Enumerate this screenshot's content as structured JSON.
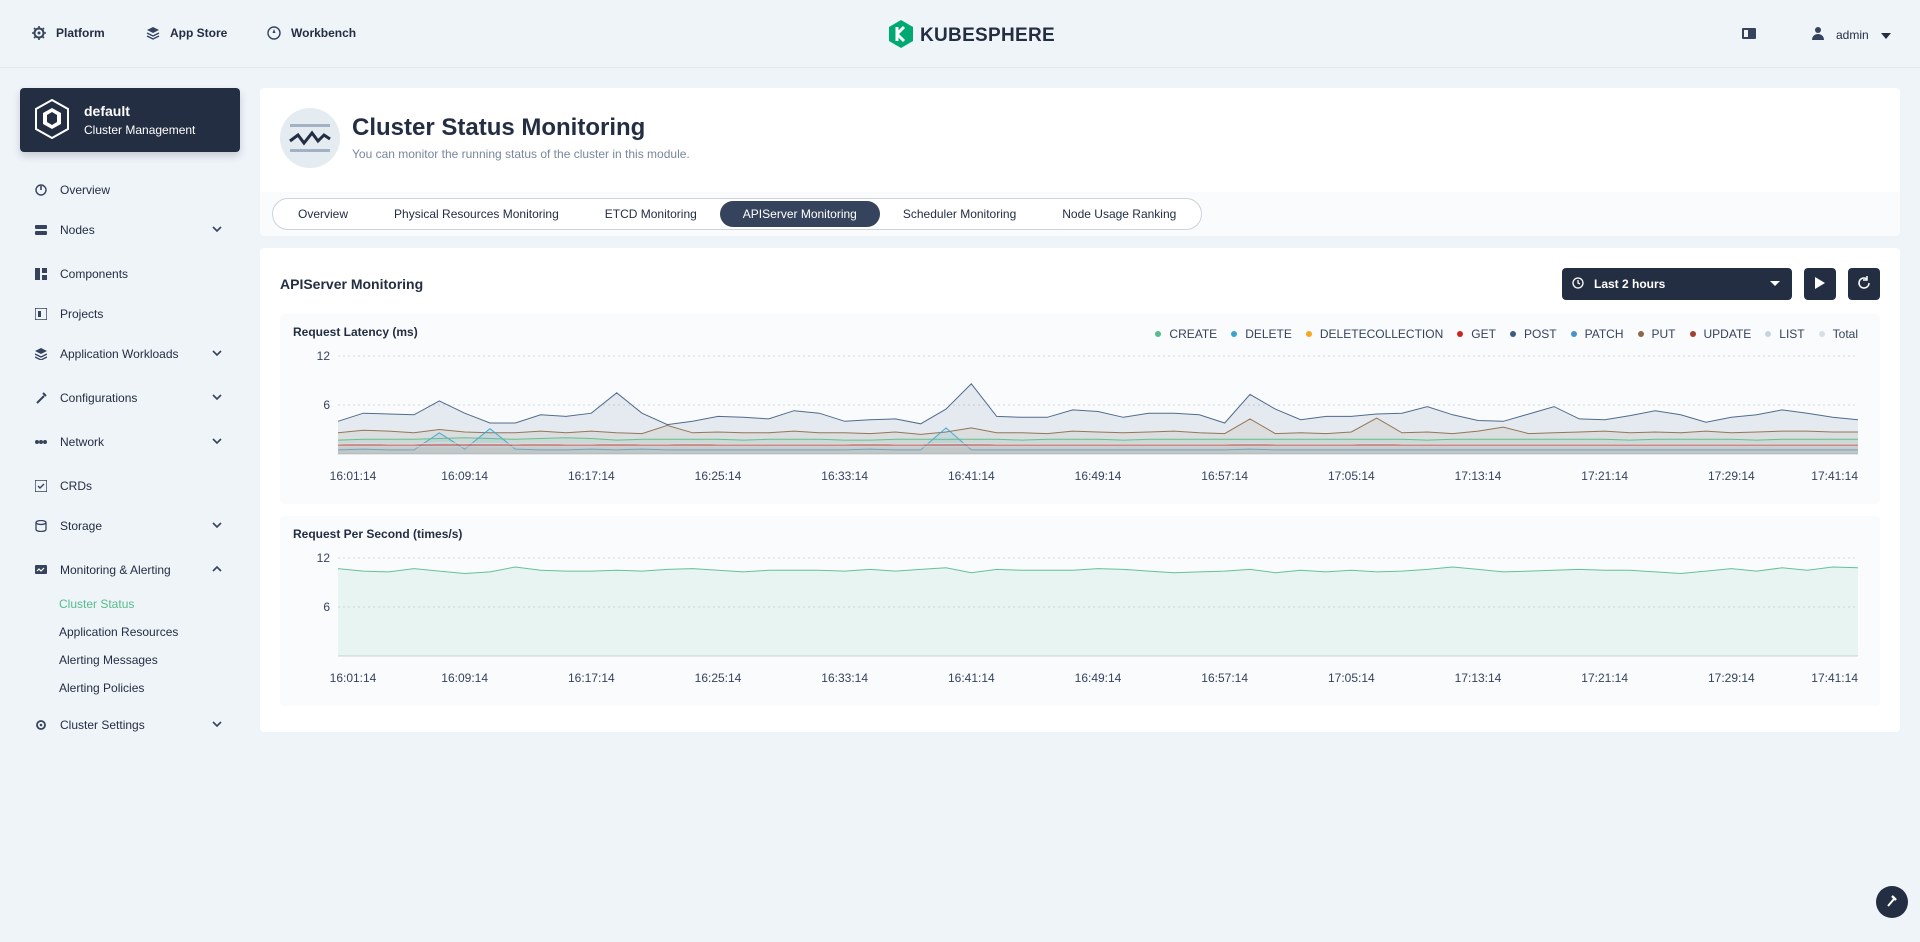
{
  "topnav": {
    "items": [
      {
        "label": "Platform",
        "icon": "gear-icon"
      },
      {
        "label": "App Store",
        "icon": "cube-icon"
      },
      {
        "label": "Workbench",
        "icon": "compass-icon"
      }
    ],
    "logo_text": "KUBESPHERE",
    "user": "admin"
  },
  "cluster": {
    "name": "default",
    "subtitle": "Cluster Management"
  },
  "sidebar": {
    "items": [
      {
        "label": "Overview",
        "icon": "dashboard-icon",
        "expandable": false
      },
      {
        "label": "Nodes",
        "icon": "nodes-icon",
        "expandable": true
      },
      {
        "label": "Components",
        "icon": "components-icon",
        "expandable": false
      },
      {
        "label": "Projects",
        "icon": "projects-icon",
        "expandable": false
      },
      {
        "label": "Application Workloads",
        "icon": "workloads-icon",
        "expandable": true
      },
      {
        "label": "Configurations",
        "icon": "wrench-icon",
        "expandable": true
      },
      {
        "label": "Network",
        "icon": "network-icon",
        "expandable": true
      },
      {
        "label": "CRDs",
        "icon": "crd-icon",
        "expandable": false
      },
      {
        "label": "Storage",
        "icon": "storage-icon",
        "expandable": true
      },
      {
        "label": "Monitoring & Alerting",
        "icon": "monitor-icon",
        "expandable": true,
        "expanded": true
      },
      {
        "label": "Cluster Settings",
        "icon": "settings-icon",
        "expandable": true
      }
    ],
    "subitems": [
      {
        "label": "Cluster Status",
        "active": true
      },
      {
        "label": "Application Resources",
        "active": false
      },
      {
        "label": "Alerting Messages",
        "active": false
      },
      {
        "label": "Alerting Policies",
        "active": false
      }
    ]
  },
  "header": {
    "title": "Cluster Status Monitoring",
    "description": "You can monitor the running status of the cluster in this module."
  },
  "tabs": [
    {
      "label": "Overview",
      "active": false
    },
    {
      "label": "Physical Resources Monitoring",
      "active": false
    },
    {
      "label": "ETCD Monitoring",
      "active": false
    },
    {
      "label": "APIServer Monitoring",
      "active": true
    },
    {
      "label": "Scheduler Monitoring",
      "active": false
    },
    {
      "label": "Node Usage Ranking",
      "active": false
    }
  ],
  "panel": {
    "title": "APIServer Monitoring",
    "time_range": "Last 2 hours"
  },
  "colors": {
    "accent": "#55bc8a",
    "dark": "#242e42",
    "CREATE": "#55bc8a",
    "DELETE": "#3ba3d1",
    "DELETECOLLECTION": "#f5a623",
    "GET": "#ca2621",
    "POST": "#3f5c7f",
    "PATCH": "#4a90c9",
    "PUT": "#8a6a48",
    "UPDATE": "#a0422f",
    "LIST": "#c6d4e2",
    "Total": "#d8dee5"
  },
  "chart_data": [
    {
      "type": "area",
      "title": "Request Latency (ms)",
      "ylim": [
        0,
        12
      ],
      "yticks": [
        12,
        6
      ],
      "xticks": [
        "16:01:14",
        "16:09:14",
        "16:17:14",
        "16:25:14",
        "16:33:14",
        "16:41:14",
        "16:49:14",
        "16:57:14",
        "17:05:14",
        "17:13:14",
        "17:21:14",
        "17:29:14",
        "17:41:14"
      ],
      "legend": [
        "CREATE",
        "DELETE",
        "DELETECOLLECTION",
        "GET",
        "POST",
        "PATCH",
        "PUT",
        "UPDATE",
        "LIST",
        "Total"
      ],
      "series": [
        {
          "name": "POST",
          "values": [
            4,
            5,
            4.9,
            4.8,
            6.5,
            5,
            3.8,
            3.8,
            4.8,
            4.6,
            5,
            7.5,
            5,
            3.6,
            4,
            4.6,
            4.5,
            4.3,
            5.3,
            5,
            4,
            4.2,
            4.3,
            3.7,
            5.5,
            8.6,
            4.6,
            4.5,
            4.5,
            5.4,
            5.2,
            4.5,
            5,
            5,
            4.8,
            3.8,
            7.3,
            5.5,
            4.2,
            4.6,
            4.6,
            4.9,
            5,
            5.8,
            4.8,
            4.1,
            4,
            4.9,
            5.8,
            4.3,
            4.2,
            4.7,
            5.3,
            4.8,
            3.9,
            4.5,
            4.8,
            5.4,
            5,
            4.5,
            4.2
          ]
        },
        {
          "name": "PUT",
          "values": [
            2.6,
            2.9,
            2.8,
            2.6,
            3,
            2.7,
            2.6,
            2.6,
            2.8,
            2.6,
            2.8,
            2.6,
            2.5,
            3.5,
            2.6,
            2.7,
            2.6,
            2.6,
            2.8,
            2.6,
            2.6,
            2.5,
            2.7,
            2.4,
            2.7,
            3.2,
            2.6,
            2.6,
            2.5,
            2.8,
            2.7,
            2.6,
            2.7,
            2.8,
            2.6,
            2.5,
            4.3,
            2.5,
            2.6,
            2.5,
            2.7,
            4.4,
            2.6,
            2.7,
            2.5,
            2.8,
            3.3,
            2.5,
            2.6,
            2.7,
            2.8,
            2.6,
            2.7,
            2.6,
            2.8,
            2.6,
            2.7,
            2.8,
            2.8,
            2.7,
            2.7
          ]
        },
        {
          "name": "DELETE",
          "values": [
            0.5,
            0.6,
            0.5,
            0.5,
            2.6,
            0.6,
            3.1,
            0.6,
            0.5,
            0.5,
            0.6,
            0.5,
            0.6,
            0.5,
            0.5,
            0.5,
            0.5,
            0.5,
            0.5,
            0.5,
            0.5,
            0.6,
            0.5,
            0.5,
            3.2,
            0.5,
            0.5,
            0.5,
            0.5,
            0.5,
            0.5,
            0.5,
            0.5,
            0.5,
            0.5,
            0.5,
            0.6,
            0.5,
            0.5,
            0.5,
            0.5,
            0.5,
            0.5,
            0.5,
            0.5,
            0.5,
            0.5,
            0.5,
            0.5,
            0.5,
            0.5,
            0.5,
            0.5,
            0.5,
            0.5,
            0.5,
            0.5,
            0.5,
            0.5,
            0.5,
            0.5
          ]
        },
        {
          "name": "CREATE",
          "values": [
            1.7,
            1.8,
            1.8,
            1.8,
            1.9,
            2,
            1.9,
            1.8,
            1.9,
            2,
            1.9,
            1.7,
            1.8,
            1.8,
            1.8,
            1.8,
            1.7,
            1.8,
            1.8,
            1.8,
            1.7,
            1.7,
            1.8,
            1.8,
            1.8,
            1.8,
            1.8,
            1.7,
            1.8,
            1.8,
            1.8,
            1.7,
            1.8,
            1.8,
            1.8,
            1.8,
            1.8,
            1.8,
            1.8,
            1.8,
            1.8,
            1.8,
            1.8,
            1.7,
            1.8,
            1.8,
            1.8,
            1.8,
            1.8,
            1.8,
            1.8,
            1.7,
            1.8,
            1.8,
            1.8,
            1.8,
            1.7,
            1.8,
            1.8,
            1.8,
            1.8
          ]
        },
        {
          "name": "GET",
          "values": [
            1.1,
            1.1,
            1.1,
            1.1,
            1.1,
            1.1,
            1.1,
            1.1,
            1.1,
            1.1,
            1.1,
            1.1,
            1.1,
            1.1,
            1.1,
            1.1,
            1.1,
            1.1,
            1.1,
            1.1,
            1.1,
            1.1,
            1.1,
            1.1,
            1.1,
            1.1,
            1.1,
            1.1,
            1.1,
            1.1,
            1.1,
            1.1,
            1.1,
            1.1,
            1.1,
            1.1,
            1.1,
            1.1,
            1.1,
            1.1,
            1.1,
            1.1,
            1.1,
            1.1,
            1.1,
            1.1,
            1.1,
            1.1,
            1.1,
            1.1,
            1.1,
            1.1,
            1.1,
            1.1,
            1.1,
            1.1,
            1.1,
            1.1,
            1.1,
            1.1,
            1.1
          ]
        },
        {
          "name": "LIST",
          "values": [
            0.9,
            0.9,
            0.9,
            0.9,
            0.9,
            0.9,
            0.9,
            0.9,
            0.9,
            0.9,
            0.9,
            0.9,
            0.9,
            0.9,
            0.9,
            0.9,
            0.9,
            0.9,
            0.9,
            0.9,
            0.9,
            0.9,
            0.9,
            0.9,
            0.9,
            0.9,
            0.9,
            0.9,
            0.9,
            0.9,
            0.9,
            0.9,
            0.9,
            0.9,
            0.9,
            0.9,
            0.9,
            0.9,
            0.9,
            0.9,
            0.9,
            0.9,
            0.9,
            0.9,
            0.9,
            0.9,
            0.9,
            0.9,
            0.9,
            0.9,
            0.9,
            0.9,
            0.9,
            0.9,
            0.9,
            0.9,
            0.9,
            0.9,
            0.9,
            0.9,
            0.9
          ]
        },
        {
          "name": "Total",
          "values": [
            1.2,
            1.3,
            1.2,
            1.2,
            1.4,
            1.3,
            1.3,
            1.2,
            1.3,
            1.2,
            1.2,
            1.3,
            1.2,
            1.2,
            1.3,
            1.2,
            1.2,
            1.2,
            1.2,
            1.2,
            1.2,
            1.3,
            1.2,
            1.2,
            1.3,
            1.3,
            1.2,
            1.2,
            1.2,
            1.2,
            1.2,
            1.2,
            1.2,
            1.2,
            1.2,
            1.2,
            1.3,
            1.2,
            1.2,
            1.2,
            1.2,
            1.3,
            1.2,
            1.2,
            1.2,
            1.2,
            1.2,
            1.2,
            1.2,
            1.2,
            1.2,
            1.2,
            1.2,
            1.2,
            1.2,
            1.2,
            1.2,
            1.2,
            1.2,
            1.2,
            1.2
          ]
        }
      ]
    },
    {
      "type": "area",
      "title": "Request Per Second (times/s)",
      "ylim": [
        0,
        12
      ],
      "yticks": [
        12,
        6
      ],
      "xticks": [
        "16:01:14",
        "16:09:14",
        "16:17:14",
        "16:25:14",
        "16:33:14",
        "16:41:14",
        "16:49:14",
        "16:57:14",
        "17:05:14",
        "17:13:14",
        "17:21:14",
        "17:29:14",
        "17:41:14"
      ],
      "series": [
        {
          "name": "",
          "values": [
            10.7,
            10.4,
            10.3,
            10.7,
            10.4,
            10.1,
            10.3,
            10.9,
            10.5,
            10.4,
            10.4,
            10.5,
            10.4,
            10.6,
            10.7,
            10.5,
            10.3,
            10.5,
            10.5,
            10.5,
            10.4,
            10.6,
            10.4,
            10.6,
            10.8,
            10.2,
            10.6,
            10.5,
            10.5,
            10.5,
            10.7,
            10.6,
            10.4,
            10.2,
            10.3,
            10.4,
            10.6,
            10.2,
            10.5,
            10.3,
            10.5,
            10.3,
            10.4,
            10.6,
            10.9,
            10.6,
            10.3,
            10.4,
            10.5,
            10.6,
            10.5,
            10.5,
            10.3,
            10.1,
            10.4,
            10.7,
            10.4,
            10.8,
            10.5,
            10.9,
            10.8
          ]
        }
      ]
    }
  ]
}
